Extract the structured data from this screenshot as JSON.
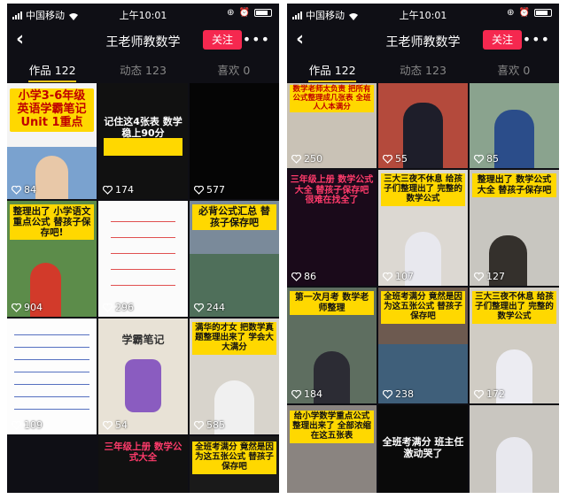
{
  "status": {
    "carrier": "中国移动",
    "time": "上午10:01"
  },
  "nav": {
    "title": "王老师教数学",
    "follow": "关注"
  },
  "tabs": [
    {
      "label": "作品 122"
    },
    {
      "label": "动态 123"
    },
    {
      "label": "喜欢 0"
    }
  ],
  "left_grid": [
    {
      "likes": "84",
      "caption": "小学3-6年级 英语学霸笔记 Unit 1重点"
    },
    {
      "likes": "174",
      "caption": "记住这4张表 数学稳上90分"
    },
    {
      "likes": "577",
      "caption": ""
    },
    {
      "likes": "904",
      "caption": "整理出了 小学语文重点公式 替孩子保存吧!"
    },
    {
      "likes": "296",
      "caption": ""
    },
    {
      "likes": "244",
      "caption": "必背公式汇总 替孩子保存吧"
    },
    {
      "likes": "109",
      "caption": ""
    },
    {
      "likes": "54",
      "caption": "学霸笔记"
    },
    {
      "likes": "585",
      "caption": "满华的才女 把数学真题整理出来了 学会大大满分"
    },
    {
      "likes": "",
      "caption": ""
    },
    {
      "likes": "",
      "caption": "三年级上册 数学公式大全"
    },
    {
      "likes": "",
      "caption": "全班考满分 竟然是因为这五张公式 替孩子保存吧"
    }
  ],
  "right_grid": [
    {
      "likes": "250",
      "caption": "数学老师太负责 把所有公式整理成几张表 全班人人本满分"
    },
    {
      "likes": "55",
      "caption": ""
    },
    {
      "likes": "85",
      "caption": ""
    },
    {
      "likes": "86",
      "caption": "三年级上册 数学公式大全 替孩子保存吧 很难在找全了"
    },
    {
      "likes": "107",
      "caption": "三大三夜不休息 给孩子们整理出了 完整的数学公式"
    },
    {
      "likes": "127",
      "caption": "整理出了 数学公式大全 替孩子保存吧"
    },
    {
      "likes": "184",
      "caption": "第一次月考 数学老师整理"
    },
    {
      "likes": "238",
      "caption": "全班考满分 竟然是因为这五张公式 替孩子保存吧"
    },
    {
      "likes": "172",
      "caption": "三大三夜不休息 给孩子们整理出了 完整的数学公式"
    },
    {
      "likes": "",
      "caption": "给小学数学重点公式 整理出来了 全部浓缩在这五张表"
    },
    {
      "likes": "",
      "caption": "全班考满分 班主任 激动哭了"
    },
    {
      "likes": "",
      "caption": ""
    }
  ],
  "colors": {
    "follow_bg": "#f5284f",
    "tab_indicator": "#f5c518",
    "caption_yellow": "#ffd800",
    "bg": "#0f0f15"
  }
}
